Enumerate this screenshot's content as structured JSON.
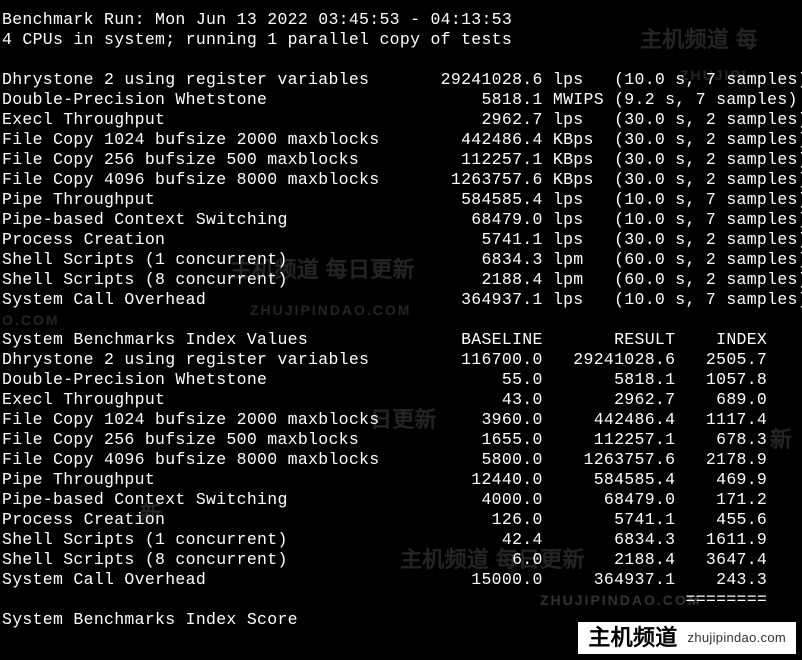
{
  "header": {
    "run_line": "Benchmark Run: Mon Jun 13 2022 03:45:53 - 04:13:53",
    "cpu_line": "4 CPUs in system; running 1 parallel copy of tests"
  },
  "results": [
    {
      "name": "Dhrystone 2 using register variables",
      "value": "29241028.6",
      "unit": "lps",
      "timing": "(10.0 s, 7 samples)"
    },
    {
      "name": "Double-Precision Whetstone",
      "value": "5818.1",
      "unit": "MWIPS",
      "timing": "(9.2 s, 7 samples)"
    },
    {
      "name": "Execl Throughput",
      "value": "2962.7",
      "unit": "lps",
      "timing": "(30.0 s, 2 samples)"
    },
    {
      "name": "File Copy 1024 bufsize 2000 maxblocks",
      "value": "442486.4",
      "unit": "KBps",
      "timing": "(30.0 s, 2 samples)"
    },
    {
      "name": "File Copy 256 bufsize 500 maxblocks",
      "value": "112257.1",
      "unit": "KBps",
      "timing": "(30.0 s, 2 samples)"
    },
    {
      "name": "File Copy 4096 bufsize 8000 maxblocks",
      "value": "1263757.6",
      "unit": "KBps",
      "timing": "(30.0 s, 2 samples)"
    },
    {
      "name": "Pipe Throughput",
      "value": "584585.4",
      "unit": "lps",
      "timing": "(10.0 s, 7 samples)"
    },
    {
      "name": "Pipe-based Context Switching",
      "value": "68479.0",
      "unit": "lps",
      "timing": "(10.0 s, 7 samples)"
    },
    {
      "name": "Process Creation",
      "value": "5741.1",
      "unit": "lps",
      "timing": "(30.0 s, 2 samples)"
    },
    {
      "name": "Shell Scripts (1 concurrent)",
      "value": "6834.3",
      "unit": "lpm",
      "timing": "(60.0 s, 2 samples)"
    },
    {
      "name": "Shell Scripts (8 concurrent)",
      "value": "2188.4",
      "unit": "lpm",
      "timing": "(60.0 s, 2 samples)"
    },
    {
      "name": "System Call Overhead",
      "value": "364937.1",
      "unit": "lps",
      "timing": "(10.0 s, 7 samples)"
    }
  ],
  "index_header": {
    "title": "System Benchmarks Index Values",
    "col1": "BASELINE",
    "col2": "RESULT",
    "col3": "INDEX"
  },
  "index": [
    {
      "name": "Dhrystone 2 using register variables",
      "baseline": "116700.0",
      "result": "29241028.6",
      "index": "2505.7"
    },
    {
      "name": "Double-Precision Whetstone",
      "baseline": "55.0",
      "result": "5818.1",
      "index": "1057.8"
    },
    {
      "name": "Execl Throughput",
      "baseline": "43.0",
      "result": "2962.7",
      "index": "689.0"
    },
    {
      "name": "File Copy 1024 bufsize 2000 maxblocks",
      "baseline": "3960.0",
      "result": "442486.4",
      "index": "1117.4"
    },
    {
      "name": "File Copy 256 bufsize 500 maxblocks",
      "baseline": "1655.0",
      "result": "112257.1",
      "index": "678.3"
    },
    {
      "name": "File Copy 4096 bufsize 8000 maxblocks",
      "baseline": "5800.0",
      "result": "1263757.6",
      "index": "2178.9"
    },
    {
      "name": "Pipe Throughput",
      "baseline": "12440.0",
      "result": "584585.4",
      "index": "469.9"
    },
    {
      "name": "Pipe-based Context Switching",
      "baseline": "4000.0",
      "result": "68479.0",
      "index": "171.2"
    },
    {
      "name": "Process Creation",
      "baseline": "126.0",
      "result": "5741.1",
      "index": "455.6"
    },
    {
      "name": "Shell Scripts (1 concurrent)",
      "baseline": "42.4",
      "result": "6834.3",
      "index": "1611.9"
    },
    {
      "name": "Shell Scripts (8 concurrent)",
      "baseline": "6.0",
      "result": "2188.4",
      "index": "3647.4"
    },
    {
      "name": "System Call Overhead",
      "baseline": "15000.0",
      "result": "364937.1",
      "index": "243.3"
    }
  ],
  "score": {
    "label": "System Benchmarks Index Score",
    "sep": "========"
  },
  "watermark": {
    "cn": "主机频道 每日更新",
    "url": "ZHUJIPINDAO.COM",
    "cn_partial_right": "主机频道 每",
    "url_partial": "AO.COM",
    "url_partial2": "ZHUJIPI",
    "cn_partial": "日更新",
    "cn_partial2": "新"
  },
  "corner": {
    "cn": "主机频道",
    "url": "zhujipindao.com"
  }
}
